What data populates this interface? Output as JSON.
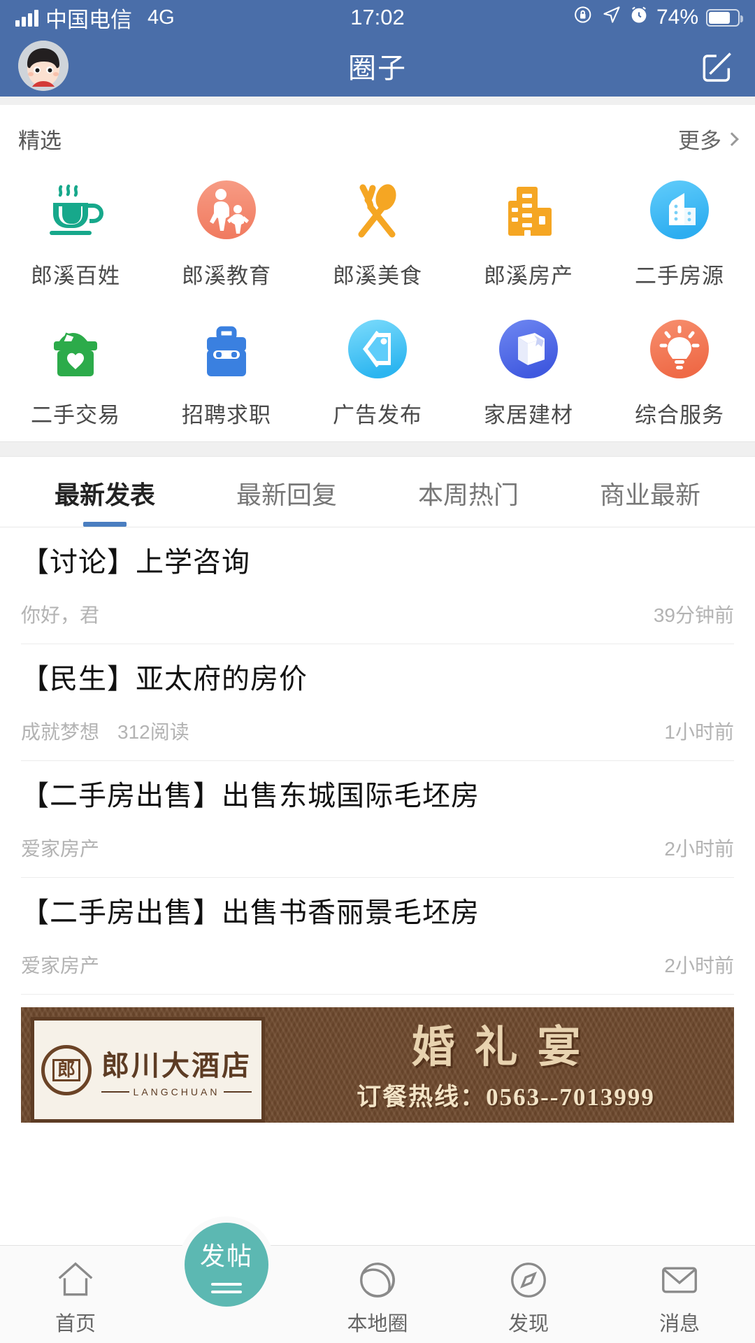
{
  "status_bar": {
    "carrier": "中国电信",
    "network": "4G",
    "time": "17:02",
    "battery_percent": "74%",
    "icons": [
      "signal-bars-icon",
      "rotation-lock-icon",
      "location-arrow-icon",
      "alarm-clock-icon",
      "battery-icon"
    ]
  },
  "header": {
    "title": "圈子",
    "avatar": "user-avatar",
    "compose_icon": "compose-icon"
  },
  "featured": {
    "section_label": "精选",
    "more_label": "更多",
    "items": [
      {
        "label": "郎溪百姓",
        "icon": "coffee-cup-icon",
        "color": "#17a88b",
        "shape": "plain"
      },
      {
        "label": "郎溪教育",
        "icon": "family-icon",
        "color": "#f48b72",
        "shape": "circle"
      },
      {
        "label": "郎溪美食",
        "icon": "fork-spoon-icon",
        "color": "#f5a623",
        "shape": "plain"
      },
      {
        "label": "郎溪房产",
        "icon": "building-icon",
        "color": "#f5a623",
        "shape": "plain"
      },
      {
        "label": "二手房源",
        "icon": "office-house-icon",
        "color": "#49bdf5",
        "shape": "circle"
      },
      {
        "label": "二手交易",
        "icon": "donation-box-icon",
        "color": "#2cab4a",
        "shape": "plain"
      },
      {
        "label": "招聘求职",
        "icon": "briefcase-icon",
        "color": "#3a80e0",
        "shape": "plain"
      },
      {
        "label": "广告发布",
        "icon": "price-tag-icon",
        "color": "#46c4f7",
        "shape": "circle"
      },
      {
        "label": "家居建材",
        "icon": "package-box-icon",
        "color": "#5270e8",
        "shape": "circle"
      },
      {
        "label": "综合服务",
        "icon": "lightbulb-icon",
        "color": "#f0704f",
        "shape": "circle"
      }
    ]
  },
  "tabs": {
    "items": [
      {
        "label": "最新发表",
        "active": true
      },
      {
        "label": "最新回复",
        "active": false
      },
      {
        "label": "本周热门",
        "active": false
      },
      {
        "label": "商业最新",
        "active": false
      }
    ]
  },
  "posts": [
    {
      "title": "【讨论】上学咨询",
      "author": "你好，君",
      "reads": "",
      "time": "39分钟前"
    },
    {
      "title": "【民生】亚太府的房价",
      "author": "成就梦想",
      "reads": "312阅读",
      "time": "1小时前"
    },
    {
      "title": "【二手房出售】出售东城国际毛坯房",
      "author": "爱家房产",
      "reads": "",
      "time": "2小时前"
    },
    {
      "title": "【二手房出售】出售书香丽景毛坯房",
      "author": "爱家房产",
      "reads": "",
      "time": "2小时前"
    }
  ],
  "ad": {
    "hotel_name": "郎川大酒店",
    "hotel_pinyin": "LANGCHUAN",
    "headline": "婚礼宴",
    "phone_line": "订餐热线：0563--7013999",
    "seal_text": "郎"
  },
  "bottom_nav": {
    "items": [
      {
        "label": "首页",
        "icon": "home-icon"
      },
      {
        "label": "本地圈",
        "icon": "aperture-icon"
      },
      {
        "label": "发现",
        "icon": "compass-icon"
      },
      {
        "label": "消息",
        "icon": "envelope-icon"
      }
    ],
    "fab_label": "发帖"
  },
  "colors": {
    "header_blue": "#4a6ea9",
    "accent_blue": "#4a7ec0",
    "fab_teal": "#5cb8b2"
  }
}
